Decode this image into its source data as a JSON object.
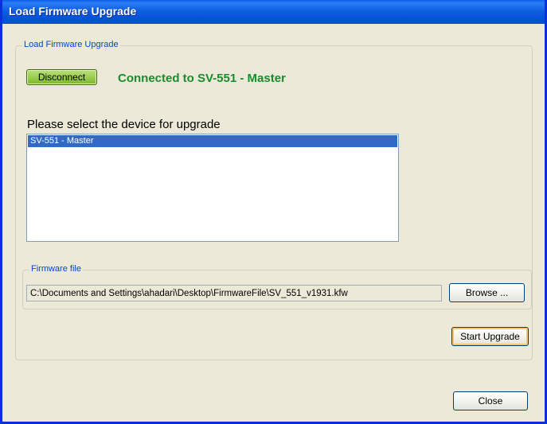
{
  "window": {
    "title": "Load Firmware Upgrade"
  },
  "group_main": {
    "legend": "Load Firmware Upgrade"
  },
  "connection": {
    "disconnect_label": "Disconnect",
    "status_text": "Connected to SV-551 - Master",
    "status_color": "#1b8b2e"
  },
  "device": {
    "prompt": "Please select the device for upgrade",
    "items": [
      "SV-551 - Master"
    ],
    "selected_index": 0
  },
  "firmware": {
    "legend": "Firmware file",
    "path": "C:\\Documents and Settings\\ahadari\\Desktop\\FirmwareFile\\SV_551_v1931.kfw",
    "browse_label": "Browse ..."
  },
  "actions": {
    "start_label": "Start Upgrade",
    "close_label": "Close"
  }
}
